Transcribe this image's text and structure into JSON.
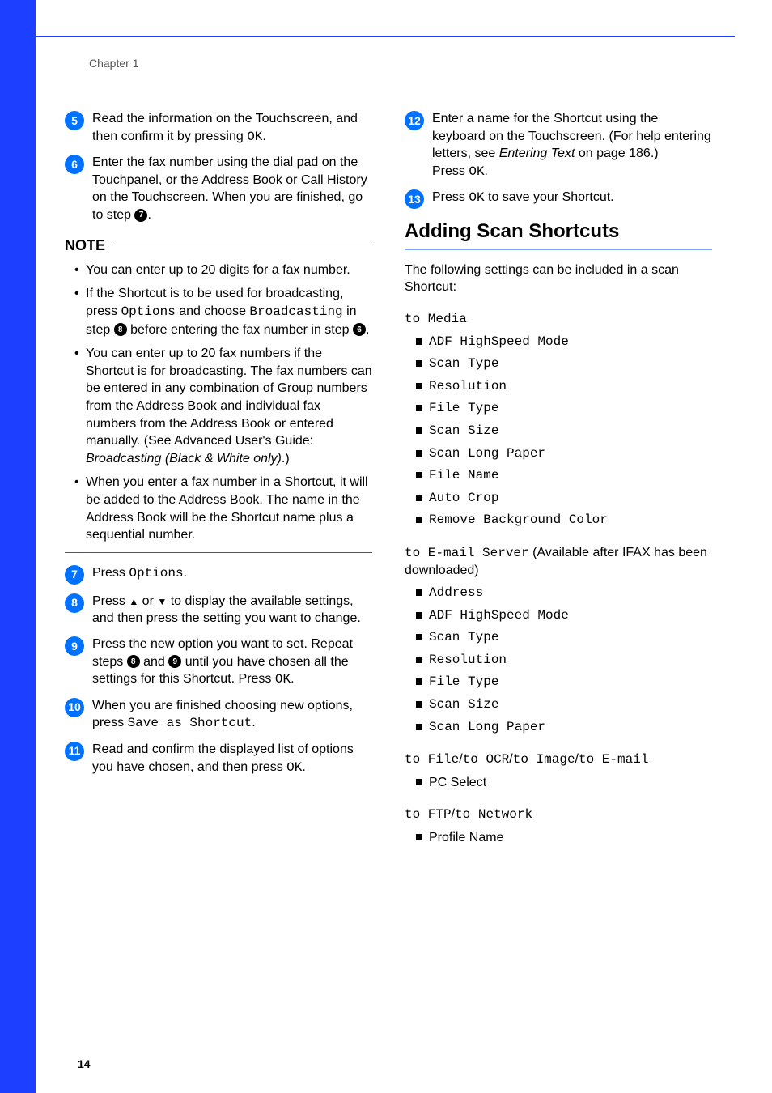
{
  "chapter": "Chapter 1",
  "page_number": "14",
  "left": {
    "step5": {
      "n": "5",
      "text_a": "Read the information on the Touchscreen, and then confirm it by pressing ",
      "text_b": "OK",
      "text_c": "."
    },
    "step6": {
      "n": "6",
      "text_a": "Enter the fax number using the dial pad on the Touchpanel, or the Address Book or Call History on the Touchscreen. When you are finished, go to step ",
      "ref": "7",
      "text_b": "."
    },
    "note_label": "NOTE",
    "notes": {
      "a": "You can enter up to 20 digits for a fax number.",
      "b_a": "If the Shortcut is to be used for broadcasting, press ",
      "b_opt": "Options",
      "b_b": " and choose ",
      "b_bc": "Broadcasting",
      "b_c": " in step ",
      "b_ref1": "8",
      "b_d": " before entering the fax number in step ",
      "b_ref2": "6",
      "b_e": ".",
      "c_a": "You can enter up to 20 fax numbers if the Shortcut is for broadcasting. The fax numbers can be entered in any combination of Group numbers from the Address Book and individual fax numbers from the Address Book or entered manually. (See Advanced User's Guide: ",
      "c_i": "Broadcasting (Black & White only)",
      "c_b": ".)",
      "d": "When you enter a fax number in a Shortcut, it will be added to the Address Book. The name in the Address Book will be the Shortcut name plus a sequential number."
    },
    "step7": {
      "n": "7",
      "a": "Press ",
      "b": "Options",
      "c": "."
    },
    "step8": {
      "n": "8",
      "a": "Press ",
      "up": "▲",
      "mid1": " or ",
      "down": "▼",
      "b": " to display the available settings, and then press the setting you want to change."
    },
    "step9": {
      "n": "9",
      "a": "Press the new option you want to set. Repeat steps ",
      "r1": "8",
      "mid": " and ",
      "r2": "9",
      "b": " until you have chosen all the settings for this Shortcut. Press ",
      "ok": "OK",
      "c": "."
    },
    "step10": {
      "n": "10",
      "a": "When you are finished choosing new options, press ",
      "b": "Save as Shortcut",
      "c": "."
    },
    "step11": {
      "n": "11",
      "a": "Read and confirm the displayed list of options you have chosen, and then press ",
      "b": "OK",
      "c": "."
    }
  },
  "right": {
    "step12": {
      "n": "12",
      "a": "Enter a name for the Shortcut using the keyboard on the Touchscreen. (For help entering letters, see ",
      "i": "Entering Text",
      "b": " on page 186.)",
      "c": "Press ",
      "ok": "OK",
      "d": "."
    },
    "step13": {
      "n": "13",
      "a": "Press ",
      "ok": "OK",
      "b": " to save your Shortcut."
    },
    "section_title": "Adding Scan Shortcuts",
    "lead": "The following settings can be included in a scan Shortcut:",
    "sub1_label": "to Media",
    "sub1_items": [
      "ADF HighSpeed Mode",
      "Scan Type",
      "Resolution",
      "File Type",
      "Scan Size",
      "Scan Long Paper",
      "File Name",
      "Auto Crop",
      "Remove Background Color"
    ],
    "sub2_label_a": "to E-mail Server",
    "sub2_label_b": " (Available after IFAX has been downloaded)",
    "sub2_items": [
      "Address",
      "ADF HighSpeed Mode",
      "Scan Type",
      "Resolution",
      "File Type",
      "Scan Size",
      "Scan Long Paper"
    ],
    "sub3": {
      "a": "to File",
      "s": "/",
      "b": "to OCR",
      "c": "to Image",
      "d": "to E-mail"
    },
    "sub3_items": [
      "PC Select"
    ],
    "sub4": {
      "a": "to FTP",
      "s": "/",
      "b": "to Network"
    },
    "sub4_items": [
      "Profile Name"
    ]
  }
}
